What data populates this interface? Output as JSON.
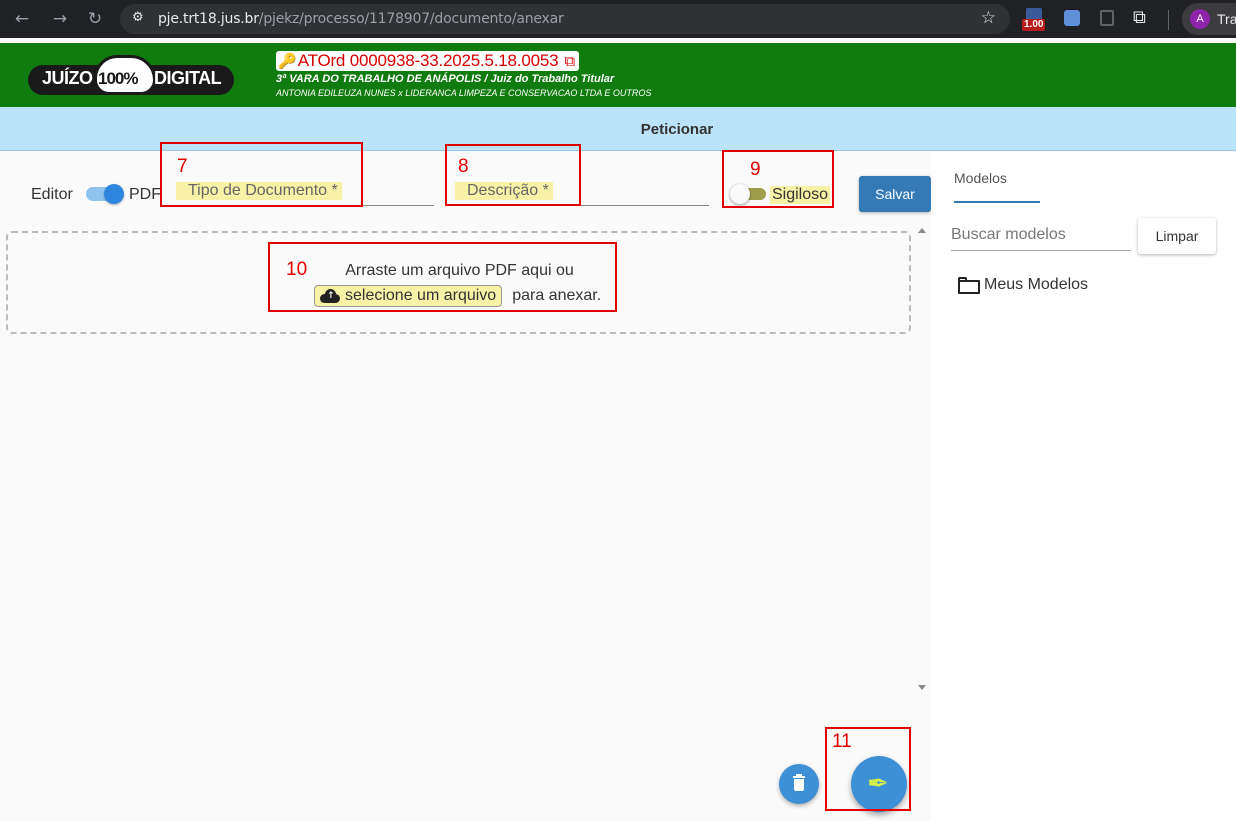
{
  "browser": {
    "back_icon": "←",
    "forward_icon": "→",
    "reload_icon": "↻",
    "tune_icon": "⚙",
    "url_host": "pje.trt18.jus.br",
    "url_path": "/pjekz/processo/1178907/documento/anexar",
    "star_icon": "☆",
    "ext_badge": "1.00",
    "puzzle_icon": "⧉",
    "profile_initial": "A",
    "profile_name": "Tra"
  },
  "header": {
    "logo_left": "JUÍZO",
    "logo_100": "100%",
    "logo_right": "DIGITAL",
    "key_icon": "🔑",
    "process_number": "ATOrd 0000938-33.2025.5.18.0053",
    "copy_icon": "⧉",
    "vara": "3ª VARA DO TRABALHO DE ANÁPOLIS / Juiz do Trabalho Titular",
    "partes": "ANTONIA EDILEUZA NUNES x LIDERANCA LIMPEZA E CONSERVACAO LTDA E OUTROS"
  },
  "page": {
    "title": "Peticionar"
  },
  "form": {
    "editor_label": "Editor",
    "pdf_label": "PDF",
    "tipo_label": "Tipo de Documento *",
    "descricao_label": "Descrição *",
    "sigiloso_label": "Sigiloso",
    "save_label": "Salvar"
  },
  "dropzone": {
    "line1": "Arraste um arquivo PDF aqui ou",
    "select_label": "selecione um arquivo",
    "line2_suffix": "para anexar."
  },
  "sidebar": {
    "tab_label": "Modelos",
    "search_placeholder": "Buscar modelos",
    "clear_label": "Limpar",
    "folder_label": "Meus Modelos"
  },
  "fab": {
    "sign_icon": "✒"
  },
  "annotations": [
    {
      "label": "7"
    },
    {
      "label": "8"
    },
    {
      "label": "9"
    },
    {
      "label": "10"
    },
    {
      "label": "11"
    }
  ],
  "colors": {
    "header_green": "#107c10",
    "title_bar_blue": "#bbe3f9",
    "primary_blue": "#337ab7",
    "process_red": "#d50000",
    "highlight_yellow": "#f7f2a6",
    "annotation_red": "#e30000"
  }
}
